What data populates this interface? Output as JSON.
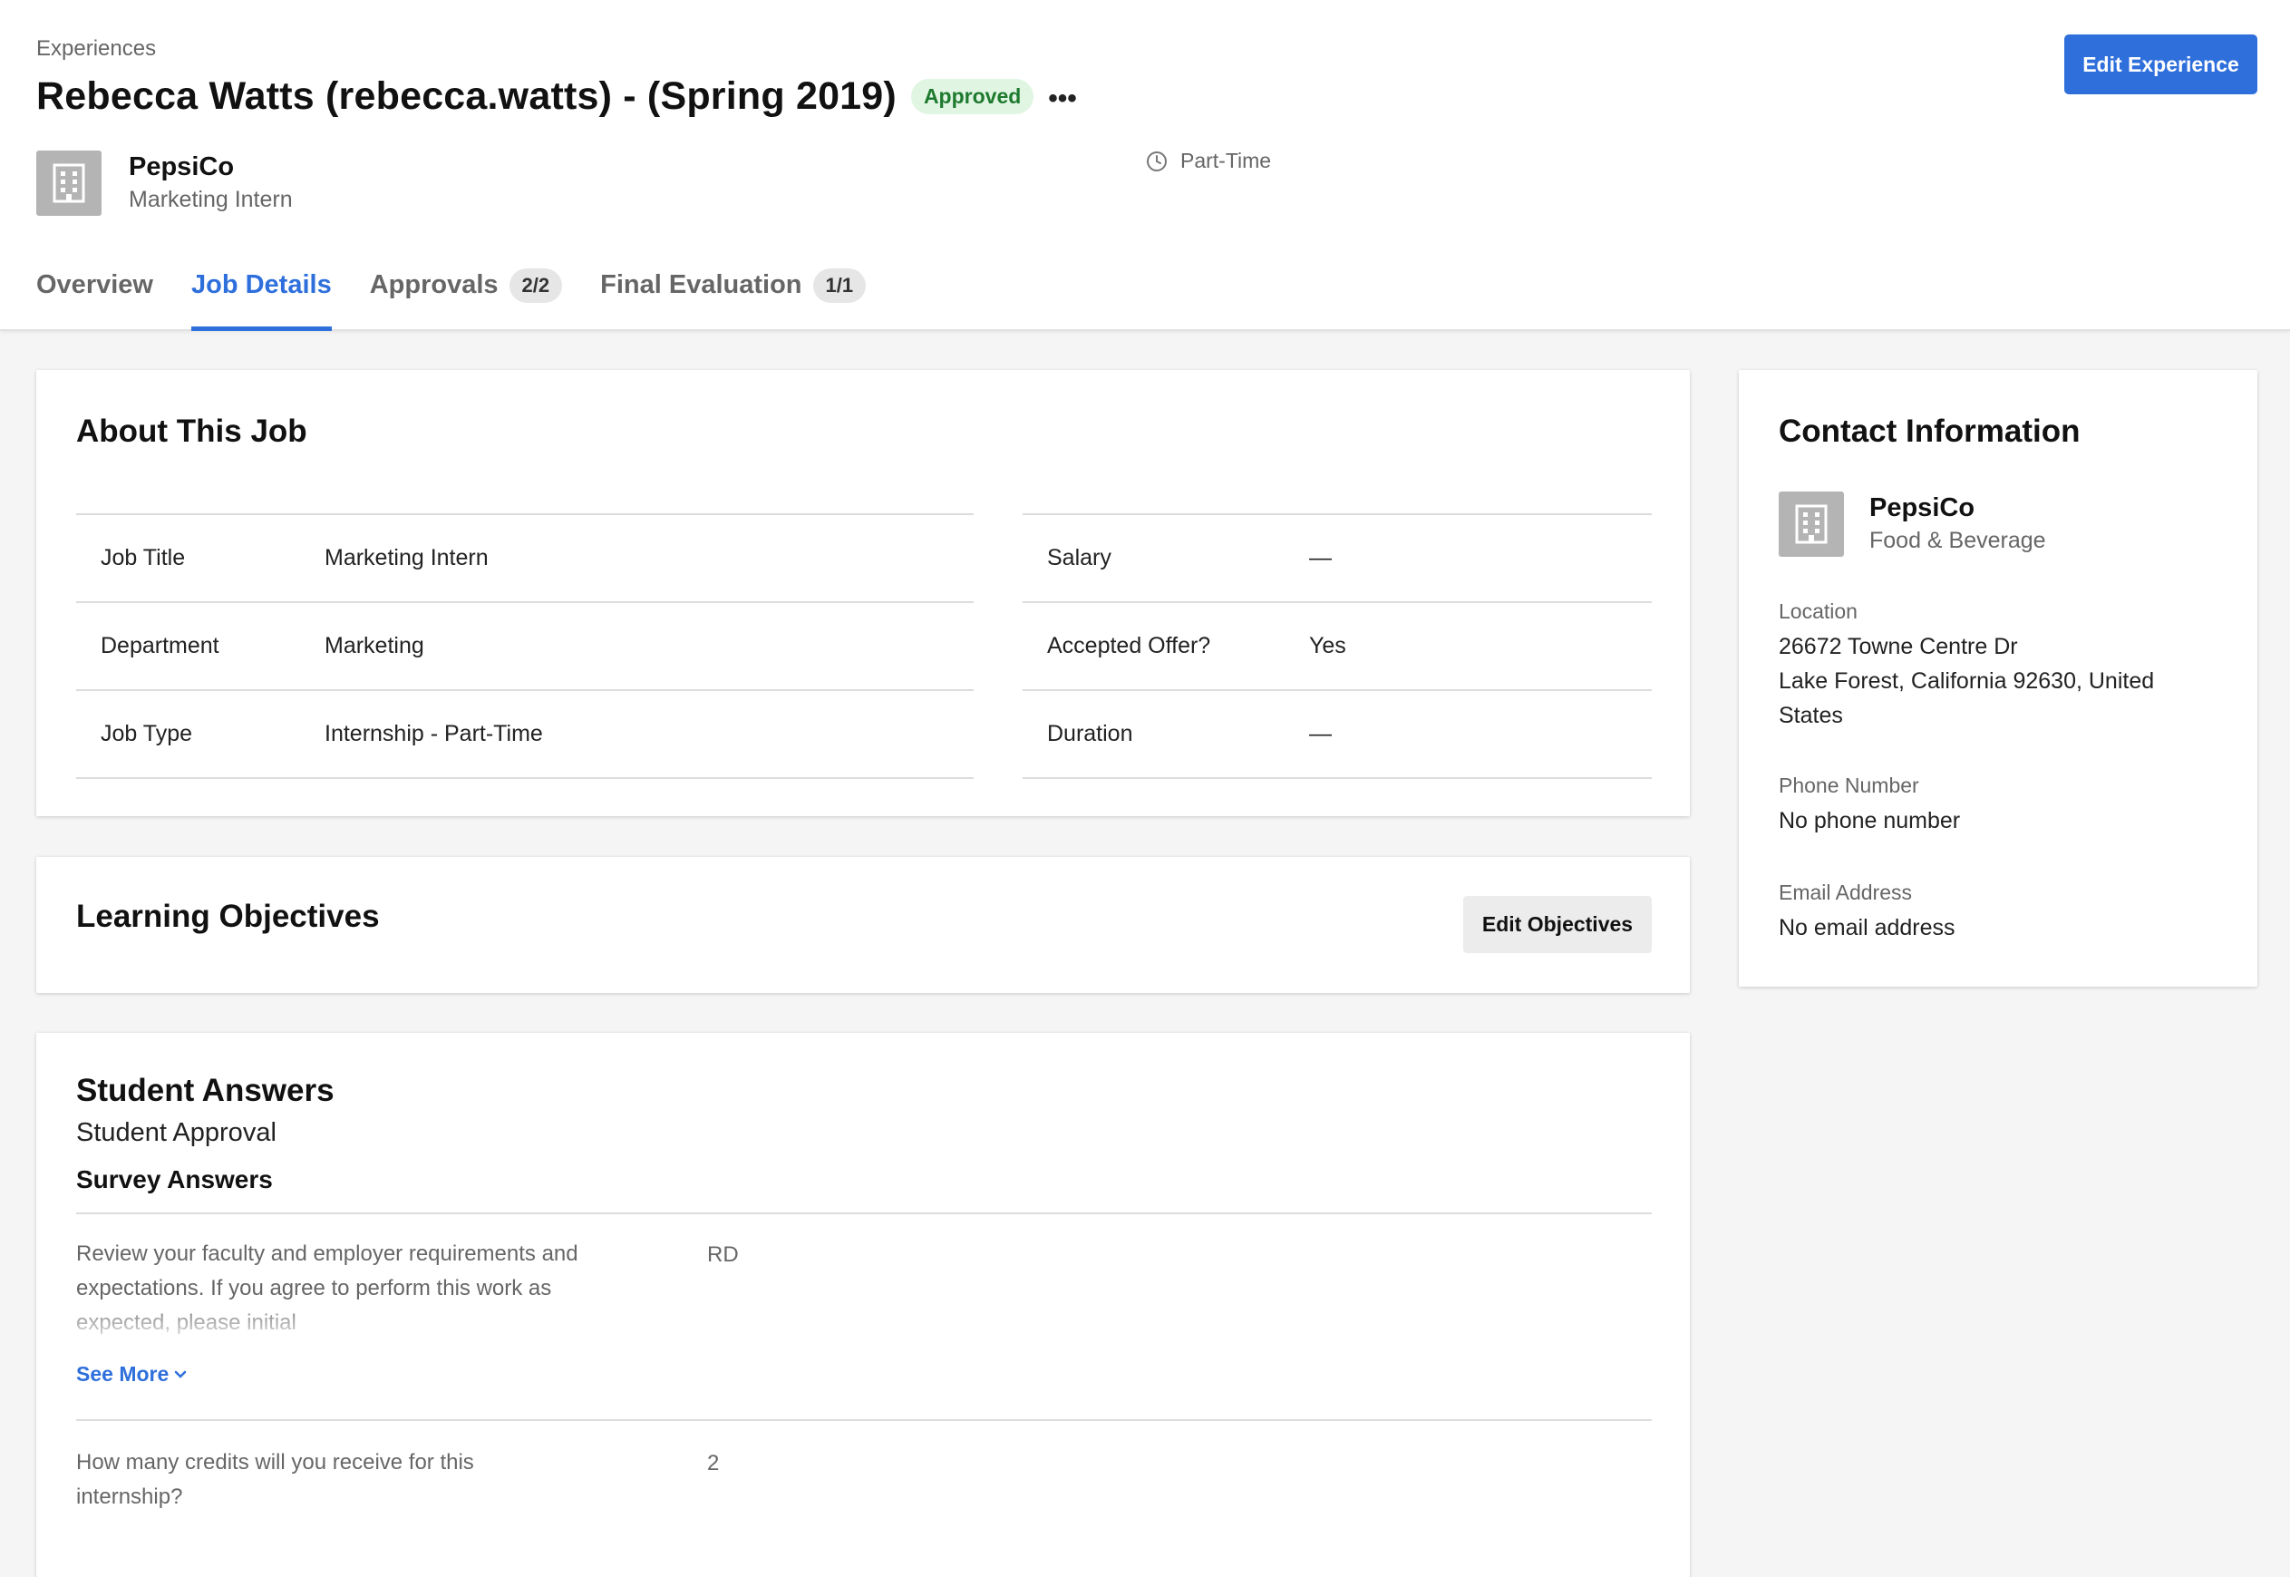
{
  "header": {
    "breadcrumb": "Experiences",
    "title": "Rebecca Watts (rebecca.watts) - (Spring 2019)",
    "status": "Approved",
    "more": "•••",
    "edit_button": "Edit Experience",
    "employer": {
      "name": "PepsiCo",
      "role": "Marketing Intern"
    },
    "schedule": "Part-Time",
    "tabs": [
      {
        "label": "Overview",
        "count": ""
      },
      {
        "label": "Job Details",
        "count": "",
        "active": true
      },
      {
        "label": "Approvals",
        "count": "2/2"
      },
      {
        "label": "Final Evaluation",
        "count": "1/1"
      }
    ]
  },
  "about": {
    "title": "About This Job",
    "left": [
      {
        "label": "Job Title",
        "value": "Marketing Intern"
      },
      {
        "label": "Department",
        "value": "Marketing"
      },
      {
        "label": "Job Type",
        "value": "Internship - Part-Time"
      }
    ],
    "right": [
      {
        "label": "Salary",
        "value": "—"
      },
      {
        "label": "Accepted Offer?",
        "value": "Yes"
      },
      {
        "label": "Duration",
        "value": "—"
      }
    ]
  },
  "objectives": {
    "title": "Learning Objectives",
    "edit_button": "Edit Objectives"
  },
  "answers": {
    "title": "Student Answers",
    "subtitle": "Student Approval",
    "section": "Survey Answers",
    "items": [
      {
        "question": "Review your faculty and employer requirements and expectations. If you agree to perform this work as expected, please initial",
        "answer": "RD"
      },
      {
        "question": "How many credits will you receive for this internship?",
        "answer": "2"
      }
    ],
    "see_more": "See More"
  },
  "contact": {
    "title": "Contact Information",
    "employer": {
      "name": "PepsiCo",
      "industry": "Food & Beverage"
    },
    "location_label": "Location",
    "location_line1": "26672 Towne Centre Dr",
    "location_line2": "Lake Forest, California 92630, United States",
    "phone_label": "Phone Number",
    "phone_value": "No phone number",
    "email_label": "Email Address",
    "email_value": "No email address"
  },
  "colors": {
    "accent": "#2e6fdc",
    "approved_bg": "#e1f5e3",
    "approved_text": "#1e7a2e",
    "icon_gray": "#b4b4b4"
  }
}
